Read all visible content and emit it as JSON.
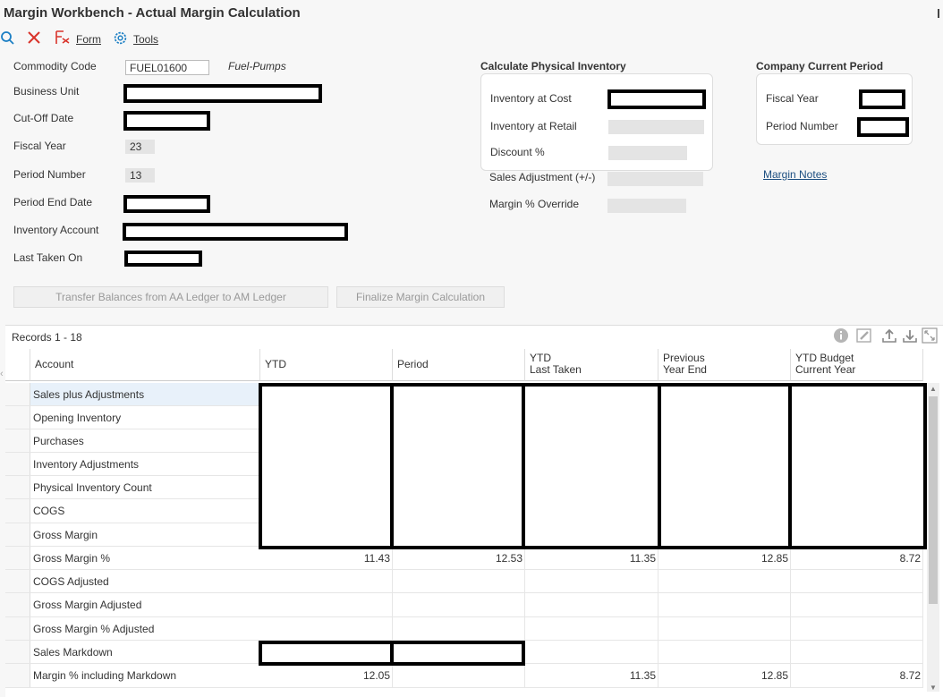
{
  "window": {
    "title": "Margin Workbench - Actual Margin Calculation"
  },
  "toolbar": {
    "form_label": "Form",
    "tools_label": "Tools"
  },
  "header": {
    "commodity_code_label": "Commodity Code",
    "commodity_code_value": "FUEL01600",
    "commodity_desc": "Fuel-Pumps",
    "business_unit_label": "Business Unit",
    "cutoff_date_label": "Cut-Off Date",
    "fiscal_year_label": "Fiscal Year",
    "fiscal_year_value": "23",
    "period_number_label": "Period Number",
    "period_number_value": "13",
    "period_end_date_label": "Period End Date",
    "inventory_account_label": "Inventory Account",
    "last_taken_on_label": "Last Taken On"
  },
  "physical_inventory": {
    "title": "Calculate Physical Inventory",
    "inventory_at_cost_label": "Inventory at Cost",
    "inventory_at_retail_label": "Inventory at Retail",
    "discount_label": "Discount %",
    "sales_adjustment_label": "Sales Adjustment (+/-)",
    "margin_override_label": "Margin % Override"
  },
  "company_period": {
    "title": "Company Current Period",
    "fiscal_year_label": "Fiscal Year",
    "period_number_label": "Period Number",
    "margin_notes_link": "Margin Notes"
  },
  "actions": {
    "transfer_label": "Transfer Balances from AA Ledger to AM Ledger",
    "finalize_label": "Finalize Margin Calculation"
  },
  "grid": {
    "records_label": "Records 1 - 18",
    "columns": {
      "account": "Account",
      "ytd": "YTD",
      "period": "Period",
      "ytd_last_1": "YTD",
      "ytd_last_2": "Last Taken",
      "prev_1": "Previous",
      "prev_2": "Year End",
      "budget_1": "YTD Budget",
      "budget_2": "Current Year"
    },
    "rows": [
      {
        "account": "Sales plus Adjustments",
        "ytd": "",
        "period": "",
        "ytd_last": "",
        "prev": "",
        "budget": ""
      },
      {
        "account": "Opening Inventory",
        "ytd": "",
        "period": "",
        "ytd_last": "",
        "prev": "",
        "budget": ""
      },
      {
        "account": "Purchases",
        "ytd": "",
        "period": "",
        "ytd_last": "",
        "prev": "",
        "budget": ""
      },
      {
        "account": "Inventory Adjustments",
        "ytd": "",
        "period": "",
        "ytd_last": "",
        "prev": "",
        "budget": ""
      },
      {
        "account": "Physical Inventory Count",
        "ytd": "",
        "period": "",
        "ytd_last": "",
        "prev": "",
        "budget": ""
      },
      {
        "account": "COGS",
        "ytd": "",
        "period": "",
        "ytd_last": "",
        "prev": "",
        "budget": ""
      },
      {
        "account": "Gross Margin",
        "ytd": "",
        "period": "",
        "ytd_last": "",
        "prev": "",
        "budget": ""
      },
      {
        "account": "Gross Margin %",
        "ytd": "11.43",
        "period": "12.53",
        "ytd_last": "11.35",
        "prev": "12.85",
        "budget": "8.72"
      },
      {
        "account": "COGS Adjusted",
        "ytd": "",
        "period": "",
        "ytd_last": "",
        "prev": "",
        "budget": ""
      },
      {
        "account": "Gross Margin Adjusted",
        "ytd": "",
        "period": "",
        "ytd_last": "",
        "prev": "",
        "budget": ""
      },
      {
        "account": "Gross Margin % Adjusted",
        "ytd": "",
        "period": "",
        "ytd_last": "",
        "prev": "",
        "budget": ""
      },
      {
        "account": "Sales Markdown",
        "ytd": "",
        "period": "",
        "ytd_last": "",
        "prev": "",
        "budget": ""
      },
      {
        "account": "Margin % including Markdown",
        "ytd": "12.05",
        "period": "",
        "ytd_last": "11.35",
        "prev": "12.85",
        "budget": "8.72"
      }
    ]
  },
  "icons": {
    "search": "search-icon",
    "close": "close-icon",
    "form": "form-icon",
    "tools": "gear-icon",
    "info": "info-icon",
    "edit": "edit-icon",
    "upload": "upload-icon",
    "download": "download-icon",
    "expand": "expand-icon"
  },
  "colors": {
    "accent": "#1c7fc4",
    "close": "#d9342b",
    "form": "#d9342b",
    "link": "#1c4e80"
  }
}
